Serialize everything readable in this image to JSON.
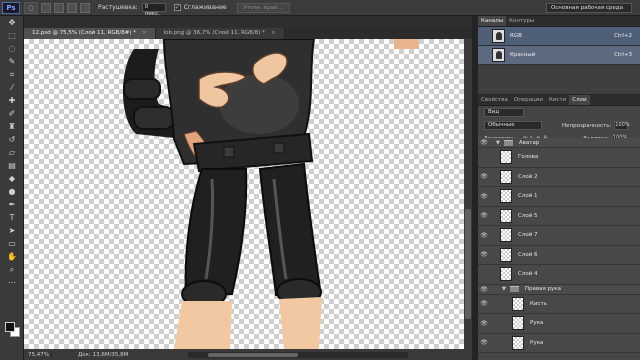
{
  "app": {
    "logo": "Ps",
    "workspace": "Основная рабочая среда"
  },
  "options": {
    "feather_label": "Растушевка:",
    "feather_value": "0 пикс.",
    "antialias_label": "Сглаживание",
    "refine_button": "Уточн. край..."
  },
  "tabs": [
    {
      "label": "12.psd @ 75,5% (Слой 11, RGB/8#) *",
      "active": true
    },
    {
      "label": "lob.png @ 36,7% (Слой 11, RGB/8) *",
      "active": false
    }
  ],
  "status": {
    "zoom": "75,47%",
    "doc": "Док: 13,6M/35,8M"
  },
  "channels_panel": {
    "tabs": [
      "Каналы",
      "Контуры"
    ],
    "rows": [
      {
        "name": "RGB",
        "shortcut": "Ctrl+2"
      },
      {
        "name": "Красный",
        "shortcut": "Ctrl+3"
      }
    ]
  },
  "layers_panel": {
    "tabs": [
      "Свойства",
      "Операции",
      "Кисти",
      "Слои"
    ],
    "kind": "Вид",
    "blend_mode": "Обычные",
    "opacity_label": "Непрозрачность:",
    "opacity_value": "100%",
    "lock_label": "Закрепить:",
    "fill_label": "Заливка:",
    "fill_value": "100%",
    "group_avatar": "Аватар",
    "layers": [
      "Голова",
      "Слой 2",
      "Слой 1",
      "Слой 5",
      "Слой 7",
      "Слой 6",
      "Слой 4"
    ],
    "group_right_hand": "Правая рука",
    "sublayers": [
      "Кисть",
      "Рука",
      "Рука"
    ]
  },
  "colors": {
    "accent": "#4f5f78",
    "panel": "#454545"
  }
}
